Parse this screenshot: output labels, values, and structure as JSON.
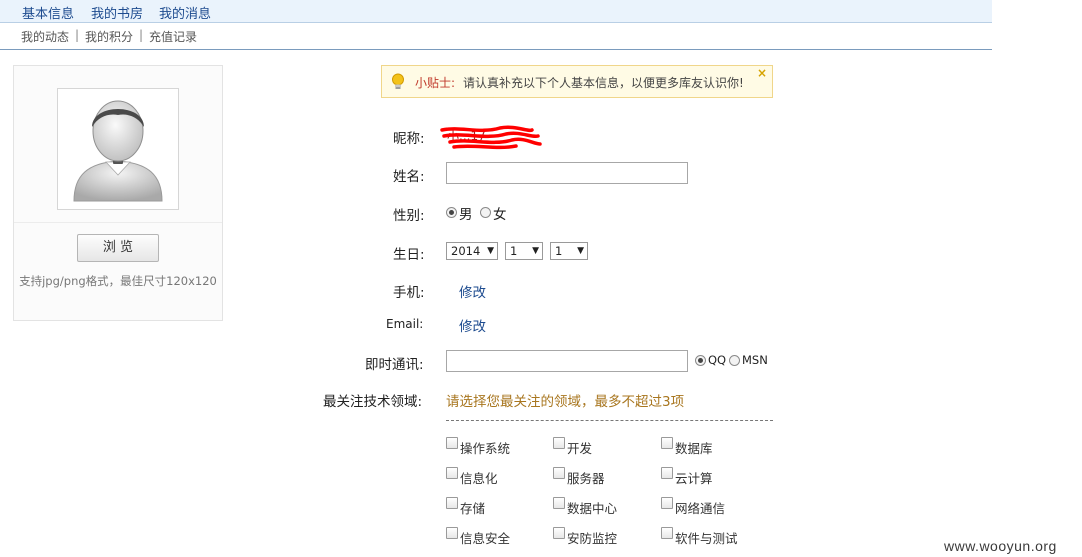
{
  "tabs": [
    "基本信息",
    "我的书房",
    "我的消息"
  ],
  "subnav": {
    "items": [
      "我的动态",
      "我的积分",
      "充值记录"
    ],
    "separator": "|"
  },
  "avatar": {
    "browse_label": "浏 览",
    "hint": "支持jpg/png格式，最佳尺寸120x120"
  },
  "tip": {
    "label": "小贴士:",
    "message": "请认真补充以下个人基本信息，以便更多库友认识你!",
    "close": "×"
  },
  "form": {
    "nickname_label": "昵称:",
    "nickname_value": "小...17",
    "name_label": "姓名:",
    "name_value": "",
    "gender_label": "性别:",
    "gender_options": [
      "男",
      "女"
    ],
    "gender_selected": "男",
    "birthday_label": "生日:",
    "birthday_year": "2014",
    "birthday_month": "1",
    "birthday_day": "1",
    "phone_label": "手机:",
    "phone_action": "修改",
    "email_label": "Email:",
    "email_action": "修改",
    "im_label": "即时通讯:",
    "im_value": "",
    "im_options": [
      "QQ",
      "MSN"
    ],
    "im_selected": "QQ",
    "focus_label": "最关注技术领域:",
    "focus_hint": "请选择您最关注的领域，最多不超过3项",
    "focus_options": [
      "操作系统",
      "开发",
      "数据库",
      "信息化",
      "服务器",
      "云计算",
      "存储",
      "数据中心",
      "网络通信",
      "信息安全",
      "安防监控",
      "软件与测试"
    ]
  },
  "watermark": "www.wooyun.org",
  "colors": {
    "link": "#1d4b8f",
    "tab_bar": "#eaf3fc",
    "hint": "#a8761f",
    "tip_label": "#c0392b"
  }
}
